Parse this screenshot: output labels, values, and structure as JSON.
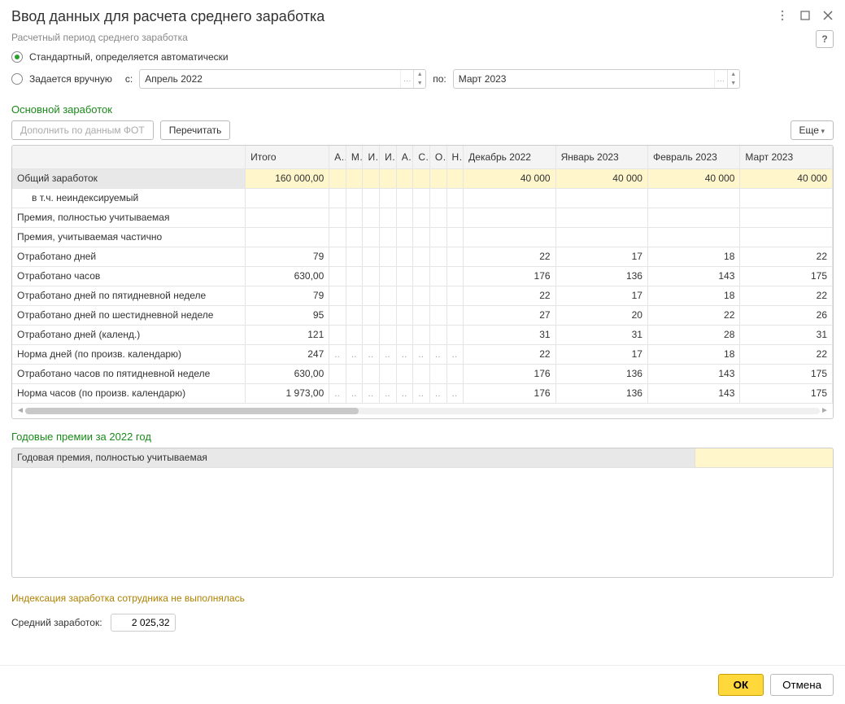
{
  "title": "Ввод данных для расчета среднего заработка",
  "period": {
    "group_label": "Расчетный период среднего заработка",
    "option_auto": "Стандартный, определяется автоматически",
    "option_manual": "Задается вручную",
    "from_label": "с:",
    "to_label": "по:",
    "from_value": "Апрель 2022",
    "to_value": "Март 2023"
  },
  "help_label": "?",
  "main_section_title": "Основной заработок",
  "toolbar": {
    "fill_by_fot": "Дополнить по данным ФОТ",
    "recalc": "Перечитать",
    "more": "Еще"
  },
  "grid": {
    "headers": {
      "total": "Итого",
      "short_months": [
        "А.",
        "М.",
        "И.",
        "И.",
        "А.",
        "С.",
        "О.",
        "Н."
      ],
      "months": [
        "Декабрь 2022",
        "Январь 2023",
        "Февраль 2023",
        "Март 2023"
      ]
    },
    "rows": [
      {
        "label": "Общий заработок",
        "total": "160 000,00",
        "vals": [
          "40 000",
          "40 000",
          "40 000",
          "40 000"
        ],
        "highlight": true
      },
      {
        "label": "в т.ч. неиндексируемый",
        "total": "",
        "vals": [
          "",
          "",
          "",
          ""
        ],
        "indent": true
      },
      {
        "label": "Премия, полностью учитываемая",
        "total": "",
        "vals": [
          "",
          "",
          "",
          ""
        ]
      },
      {
        "label": "Премия, учитываемая частично",
        "total": "",
        "vals": [
          "",
          "",
          "",
          ""
        ]
      },
      {
        "label": "Отработано дней",
        "total": "79",
        "vals": [
          "22",
          "17",
          "18",
          "22"
        ]
      },
      {
        "label": "Отработано часов",
        "total": "630,00",
        "vals": [
          "176",
          "136",
          "143",
          "175"
        ]
      },
      {
        "label": "Отработано дней по пятидневной неделе",
        "total": "79",
        "vals": [
          "22",
          "17",
          "18",
          "22"
        ]
      },
      {
        "label": "Отработано дней по шестидневной неделе",
        "total": "95",
        "vals": [
          "27",
          "20",
          "22",
          "26"
        ]
      },
      {
        "label": "Отработано дней (календ.)",
        "total": "121",
        "vals": [
          "31",
          "31",
          "28",
          "31"
        ]
      },
      {
        "label": "Норма дней (по произв. календарю)",
        "total": "247",
        "vals": [
          "22",
          "17",
          "18",
          "22"
        ],
        "dots": true
      },
      {
        "label": "Отработано часов по пятидневной неделе",
        "total": "630,00",
        "vals": [
          "176",
          "136",
          "143",
          "175"
        ]
      },
      {
        "label": "Норма часов (по произв. календарю)",
        "total": "1 973,00",
        "vals": [
          "176",
          "136",
          "143",
          "175"
        ],
        "dots": true
      }
    ]
  },
  "bonus": {
    "title": "Годовые премии за 2022 год",
    "row_label": "Годовая премия, полностью учитываемая"
  },
  "indexation_note": "Индексация заработка сотрудника не выполнялась",
  "avg": {
    "label": "Средний заработок:",
    "value": "2 025,32"
  },
  "buttons": {
    "ok": "ОК",
    "cancel": "Отмена"
  }
}
